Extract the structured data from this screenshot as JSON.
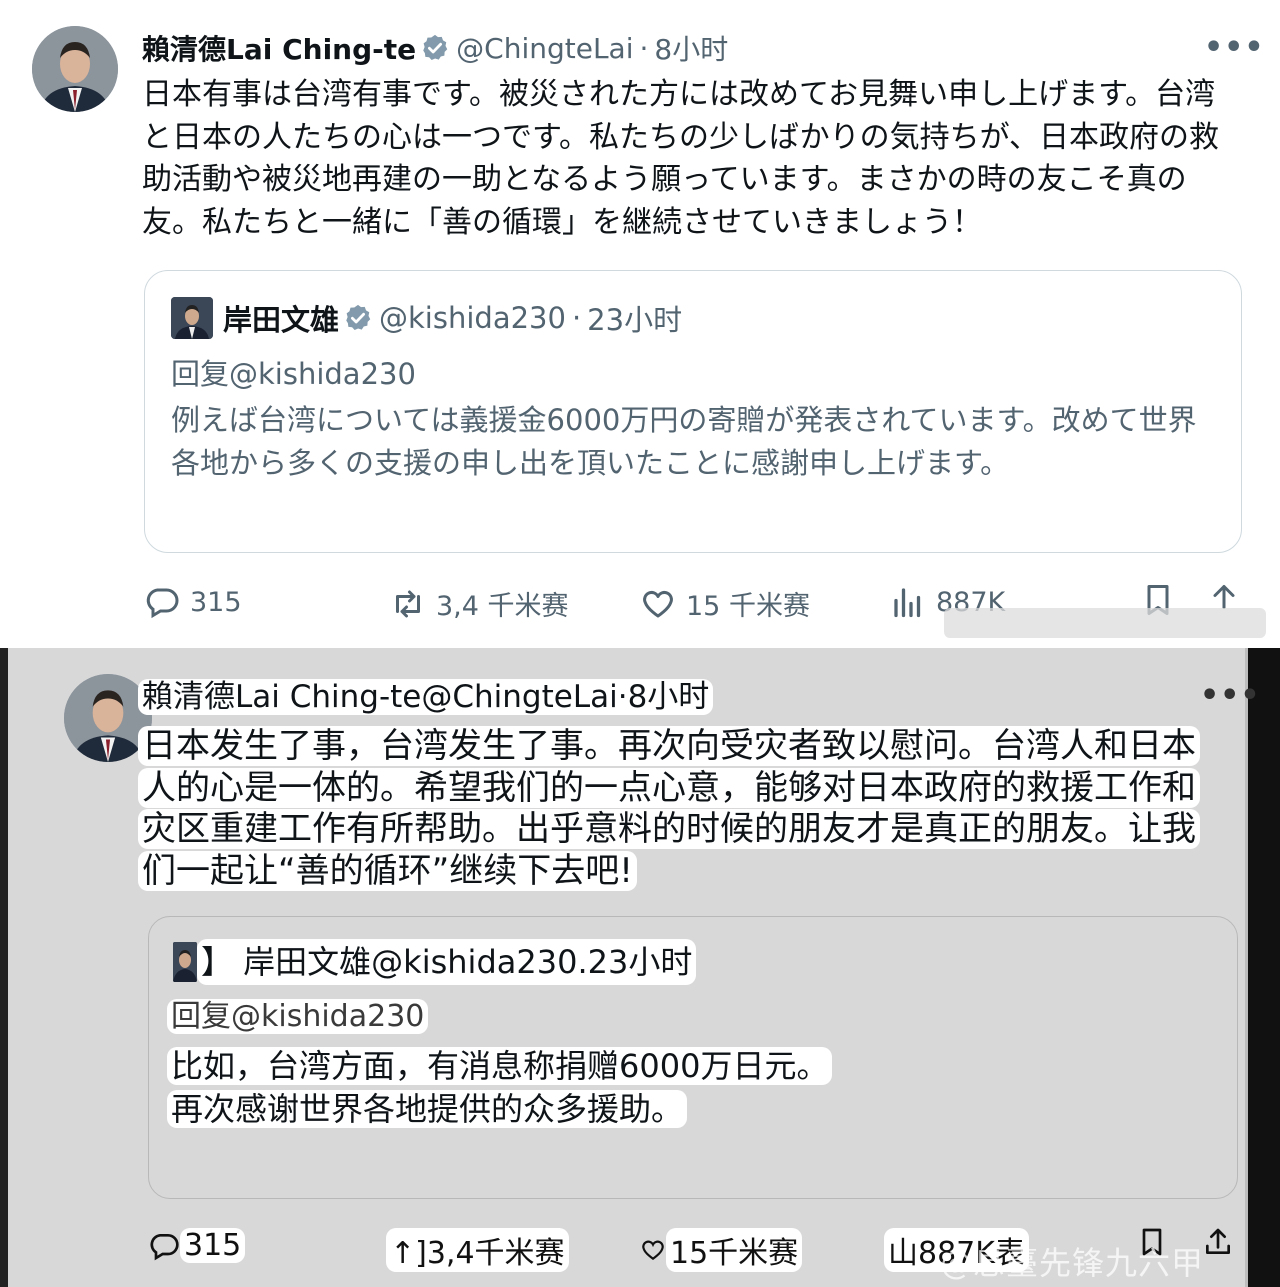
{
  "top": {
    "author": {
      "name": "賴清德Lai Ching-te",
      "handle": "@ChingteLai",
      "dot": "·",
      "time": "8小时"
    },
    "more_label": "•••",
    "body": "日本有事は台湾有事です。被災された方には改めてお見舞い申し上げます。台湾と日本の人たちの心は一つです。私たちの少しばかりの気持ちが、日本政府の救助活動や被災地再建の一助となるよう願っています。まさかの時の友こそ真の友。私たちと一緒に「善の循環」を継続させていきましょう！",
    "quote": {
      "name": "岸田文雄",
      "handle": "@kishida230",
      "dot": "·",
      "time": "23小时",
      "reply_to": "回复@kishida230",
      "body": "例えば台湾については義援金6000万円の寄贈が発表されています。改めて世界各地から多くの支援の申し出を頂いたことに感謝申し上げます。"
    },
    "actions": {
      "replies": "315",
      "reposts": "3,4 千米赛",
      "likes": "15 千米赛",
      "views": "887K"
    }
  },
  "bottom": {
    "header": "賴清德Lai Ching-te@ChingteLai·8小时",
    "more_label": "•••",
    "body": "日本发生了事，台湾发生了事。再次向受灾者致以慰问。台湾人和日本人的心是一体的。希望我们的一点心意，能够对日本政府的救援工作和灾区重建工作有所帮助。出乎意料的时候的朋友才是真正的朋友。让我们一起让“善的循环”继续下去吧!",
    "quote": {
      "header": "】 岸田文雄@kishida230.23小时",
      "reply_to": "回复@kishida230",
      "line1": "比如，台湾方面，有消息称捐赠6000万日元。",
      "line2": "再次感谢世界各地提供的众多援助。"
    },
    "actions": {
      "replies": "315",
      "reposts": "↑]3,4千米赛",
      "likes": "15千米赛",
      "views": "山887K表"
    },
    "watermark": "@息臺先锋九六甲"
  },
  "colors": {
    "text": "#0f1419",
    "secondary": "#536471",
    "verified": "#829aab",
    "border": "#cfd9de",
    "bottom_bg": "#d8d8d8",
    "highlight": "#ffffff"
  },
  "icons": [
    "verified-badge-icon",
    "reply-icon",
    "repost-icon",
    "like-icon",
    "views-icon",
    "bookmark-icon",
    "share-icon",
    "more-icon"
  ]
}
